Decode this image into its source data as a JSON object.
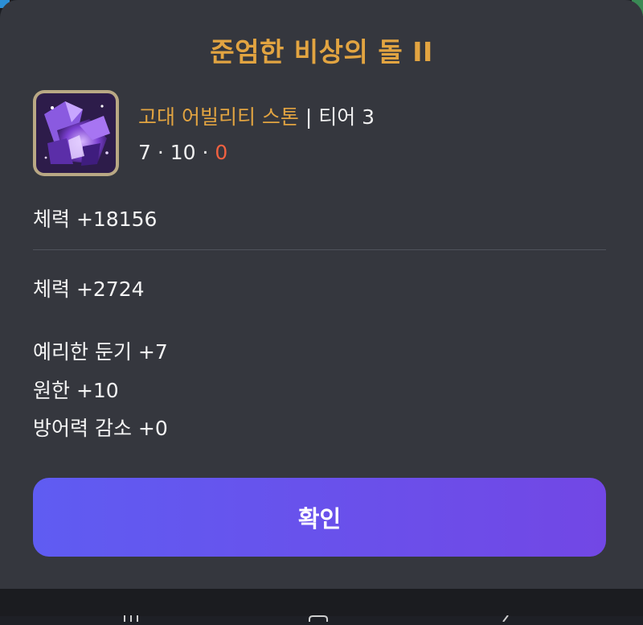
{
  "dialog": {
    "title": "준엄한 비상의 돌 II",
    "item": {
      "icon": "ability-stone-crystal-icon",
      "name": "고대 어빌리티 스톤",
      "separator": " | ",
      "tier": "티어 3",
      "levels": {
        "first": "7",
        "second": "10",
        "third": "0",
        "dot": " · "
      }
    },
    "base_stat": "체력 +18156",
    "bonus_stat": "체력 +2724",
    "engravings": [
      {
        "text": "예리한 둔기 +7",
        "color": "#f4f4f4"
      },
      {
        "text": "원한 +10",
        "color": "#f4f4f4"
      },
      {
        "text": "방어력 감소 +0",
        "color": "#f06140"
      }
    ],
    "confirm_label": "확인"
  },
  "nav_bar": {
    "icons": [
      "recent-apps-icon",
      "home-icon",
      "back-icon"
    ]
  },
  "colors": {
    "gold": "#e2a441",
    "negative": "#f06140",
    "button_gradient_start": "#5f5cf2",
    "button_gradient_end": "#7247e5",
    "sheet": "#35373e"
  }
}
